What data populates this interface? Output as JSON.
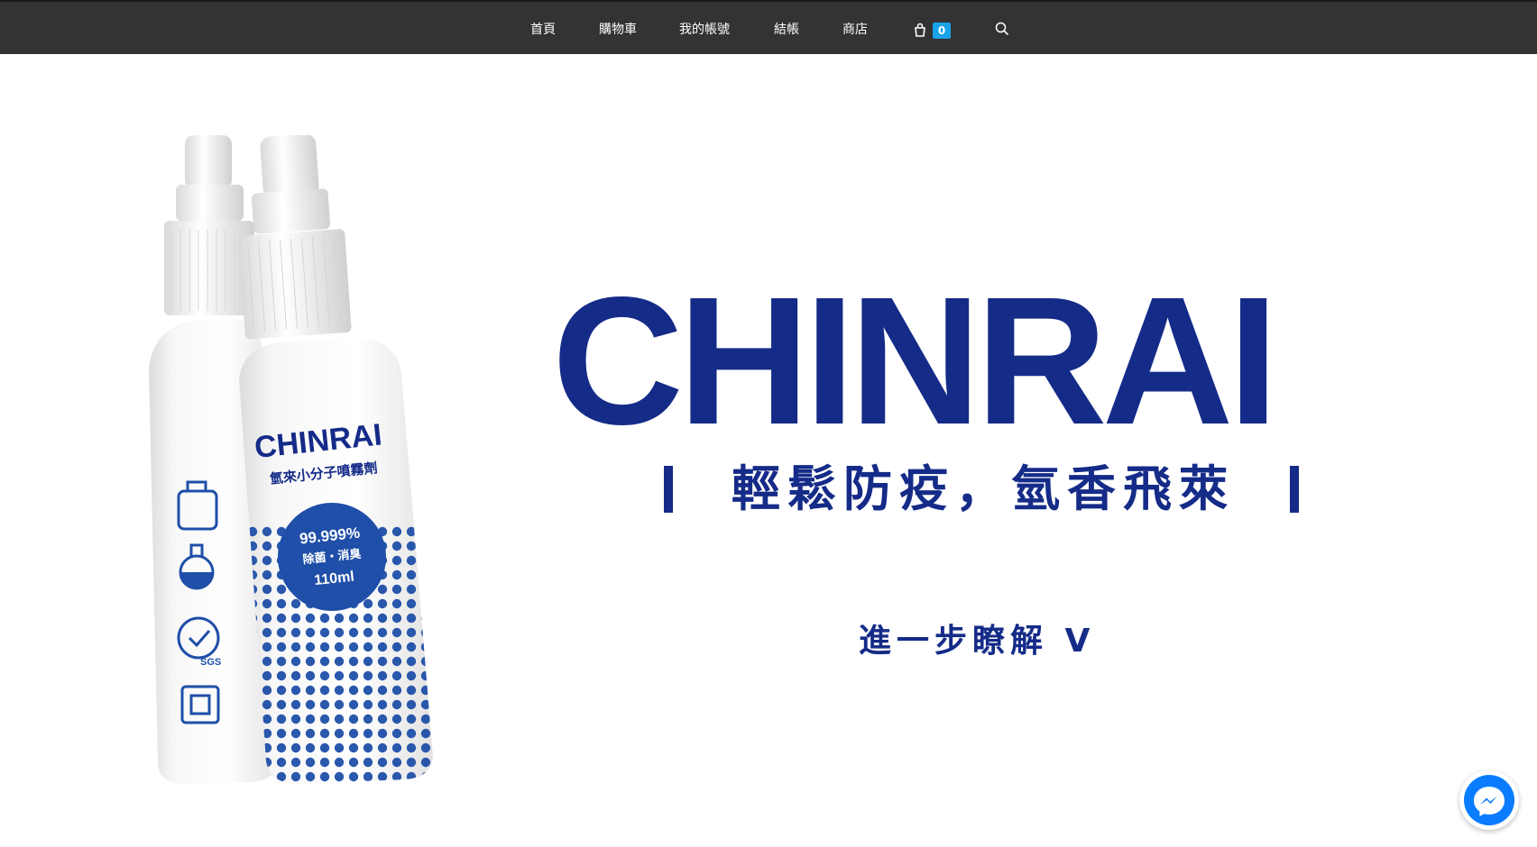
{
  "nav": {
    "items": [
      {
        "label": "首頁"
      },
      {
        "label": "購物車"
      },
      {
        "label": "我的帳號"
      },
      {
        "label": "結帳"
      },
      {
        "label": "商店"
      }
    ],
    "cart_count": "0",
    "cart_icon": "shopping-bag-icon",
    "search_icon": "search-icon"
  },
  "hero": {
    "brand": "CHINRAI",
    "tagline": "輕鬆防疫，氫香飛萊",
    "learn_more": "進一步瞭解 V",
    "product": {
      "brand": "CHINRAI",
      "name": "氫來小分子噴霧劑",
      "badge_line1": "99.999%",
      "badge_line2": "除菌・消臭",
      "badge_line3": "110ml",
      "certification": "SGS"
    }
  },
  "colors": {
    "navbar": "#333333",
    "brand_blue": "#152b88",
    "cart_badge": "#1aa3e8",
    "messenger": "#0a7cff"
  },
  "messenger": {
    "icon": "messenger-icon"
  }
}
